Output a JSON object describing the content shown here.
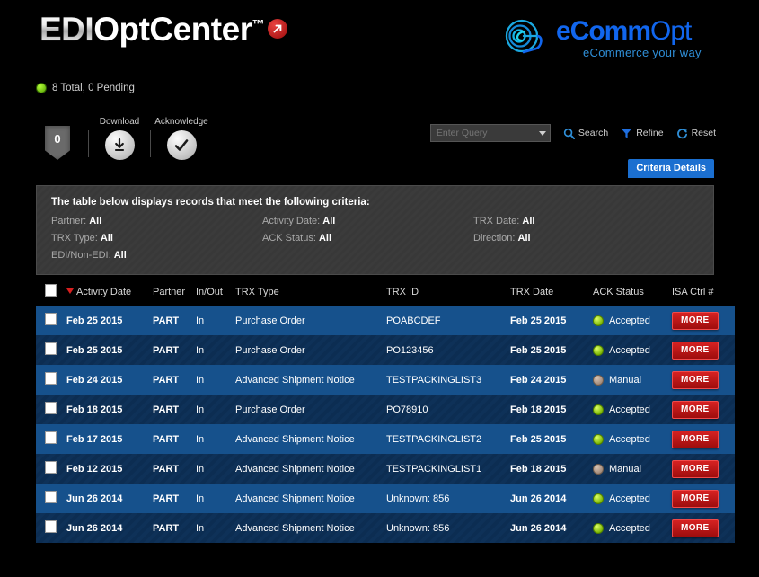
{
  "brand": {
    "edi": "EDI",
    "optcenter": "OptCenter",
    "tm": "™",
    "arrow_icon": "arrow-up-right-icon",
    "ecomm_main": "eComm",
    "ecomm_alt": "Opt",
    "ecomm_tagline": "eCommerce your way",
    "accent_blue": "#1166ee",
    "accent_red": "#c01010"
  },
  "status": {
    "text": "8 Total, 0 Pending",
    "dot_color": "#8ed400"
  },
  "toolbar": {
    "badge_count": "0",
    "download_label": "Download",
    "acknowledge_label": "Acknowledge"
  },
  "query": {
    "placeholder": "Enter Query",
    "value": "",
    "search_label": "Search",
    "refine_label": "Refine",
    "reset_label": "Reset"
  },
  "criteria": {
    "tab_label": "Criteria Details",
    "title": "The table below displays records that meet the following criteria:",
    "fields": [
      {
        "label": "Partner:",
        "value": "All"
      },
      {
        "label": "Activity Date:",
        "value": "All"
      },
      {
        "label": "TRX Date:",
        "value": "All"
      },
      {
        "label": "TRX Type:",
        "value": "All"
      },
      {
        "label": "ACK Status:",
        "value": "All"
      },
      {
        "label": "Direction:",
        "value": "All"
      },
      {
        "label": "EDI/Non-EDI:",
        "value": "All"
      }
    ]
  },
  "table": {
    "sort_column": "Activity Date",
    "sort_direction": "desc",
    "headers": [
      "Activity Date",
      "Partner",
      "In/Out",
      "TRX Type",
      "TRX ID",
      "TRX Date",
      "ACK Status",
      "ISA Ctrl #"
    ],
    "more_label": "MORE",
    "rows": [
      {
        "activity_date": "Feb 25 2015",
        "partner": "PART",
        "in_out": "In",
        "trx_type": "Purchase Order",
        "trx_id": "POABCDEF",
        "trx_date": "Feb 25 2015",
        "ack_status": "Accepted",
        "ack_state": "accepted"
      },
      {
        "activity_date": "Feb 25 2015",
        "partner": "PART",
        "in_out": "In",
        "trx_type": "Purchase Order",
        "trx_id": "PO123456",
        "trx_date": "Feb 25 2015",
        "ack_status": "Accepted",
        "ack_state": "accepted"
      },
      {
        "activity_date": "Feb 24 2015",
        "partner": "PART",
        "in_out": "In",
        "trx_type": "Advanced Shipment Notice",
        "trx_id": "TESTPACKINGLIST3",
        "trx_date": "Feb 24 2015",
        "ack_status": "Manual",
        "ack_state": "manual"
      },
      {
        "activity_date": "Feb 18 2015",
        "partner": "PART",
        "in_out": "In",
        "trx_type": "Purchase Order",
        "trx_id": "PO78910",
        "trx_date": "Feb 18 2015",
        "ack_status": "Accepted",
        "ack_state": "accepted"
      },
      {
        "activity_date": "Feb 17 2015",
        "partner": "PART",
        "in_out": "In",
        "trx_type": "Advanced Shipment Notice",
        "trx_id": "TESTPACKINGLIST2",
        "trx_date": "Feb 25 2015",
        "ack_status": "Accepted",
        "ack_state": "accepted"
      },
      {
        "activity_date": "Feb 12 2015",
        "partner": "PART",
        "in_out": "In",
        "trx_type": "Advanced Shipment Notice",
        "trx_id": "TESTPACKINGLIST1",
        "trx_date": "Feb 18 2015",
        "ack_status": "Manual",
        "ack_state": "manual"
      },
      {
        "activity_date": "Jun 26 2014",
        "partner": "PART",
        "in_out": "In",
        "trx_type": "Advanced Shipment Notice",
        "trx_id": "Unknown: 856",
        "trx_date": "Jun 26 2014",
        "ack_status": "Accepted",
        "ack_state": "accepted"
      },
      {
        "activity_date": "Jun 26 2014",
        "partner": "PART",
        "in_out": "In",
        "trx_type": "Advanced Shipment Notice",
        "trx_id": "Unknown: 856",
        "trx_date": "Jun 26 2014",
        "ack_status": "Accepted",
        "ack_state": "accepted"
      }
    ]
  }
}
